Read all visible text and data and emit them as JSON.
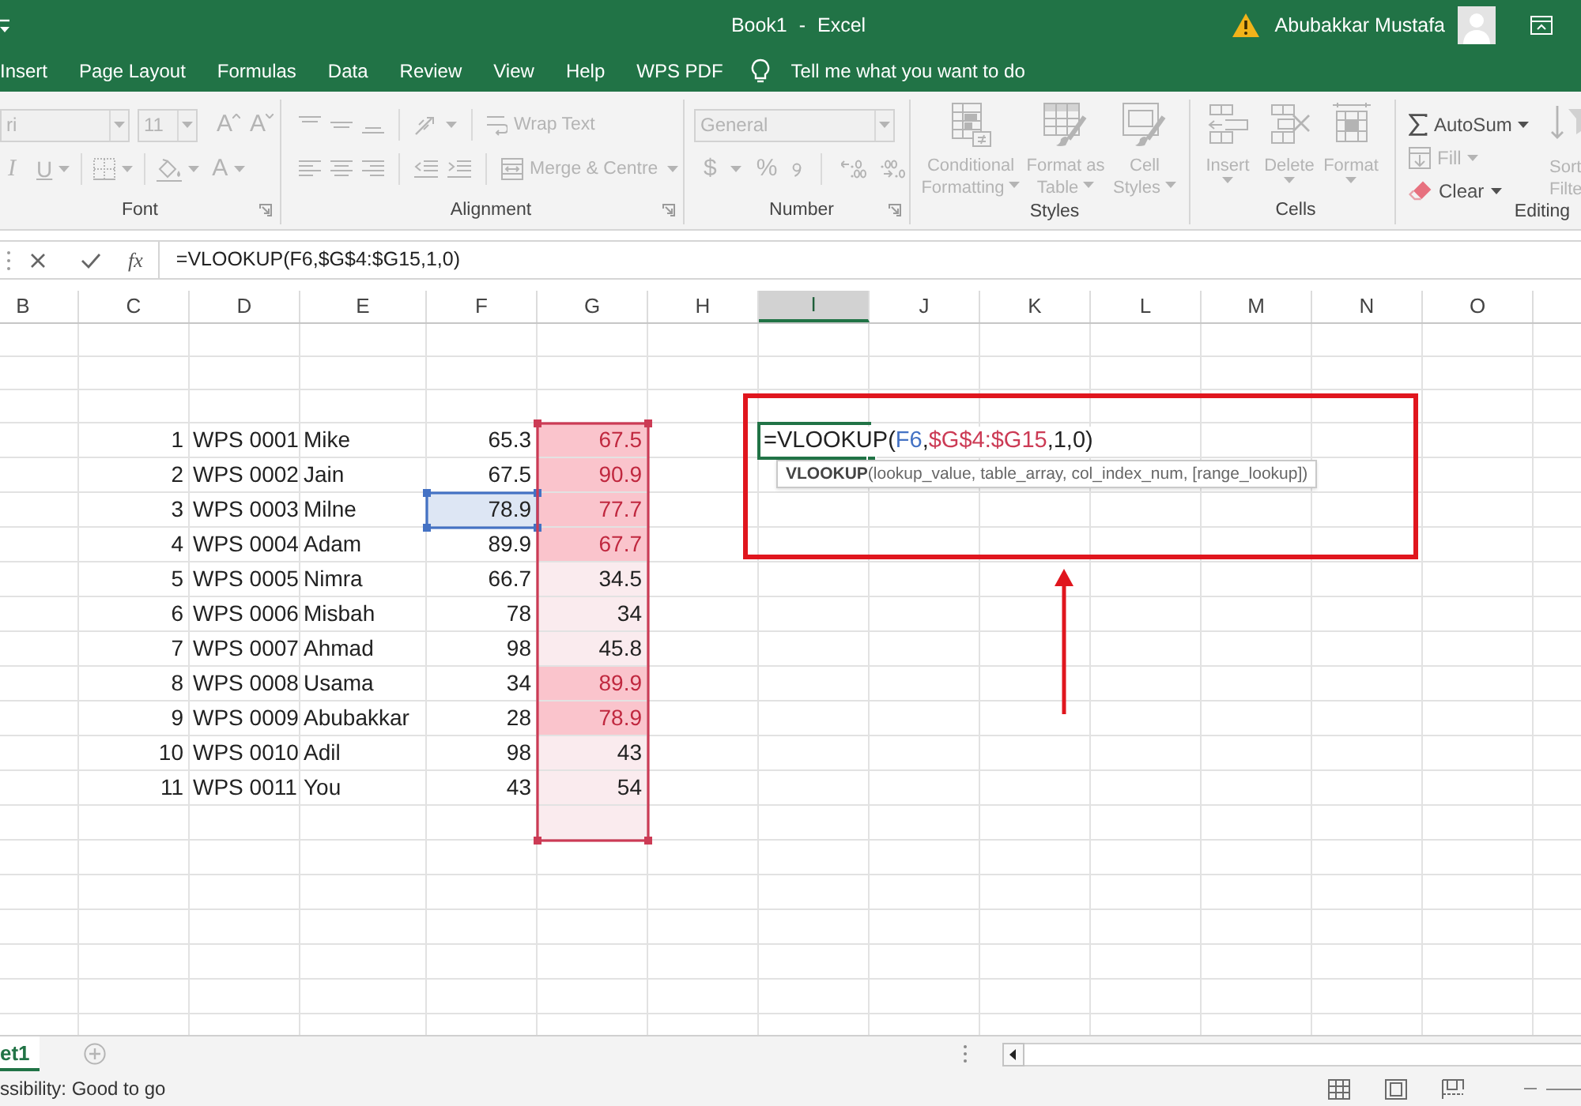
{
  "title_bar": {
    "title": "Book1 - Excel",
    "user": "Abubakkar Mustafa",
    "warning": true
  },
  "tabs": [
    {
      "label": "Insert",
      "selected": false
    },
    {
      "label": "Page Layout",
      "selected": false
    },
    {
      "label": "Formulas",
      "selected": false
    },
    {
      "label": "Data",
      "selected": false
    },
    {
      "label": "Review",
      "selected": false
    },
    {
      "label": "View",
      "selected": false
    },
    {
      "label": "Help",
      "selected": false
    },
    {
      "label": "WPS PDF",
      "selected": false
    }
  ],
  "tell_me": "Tell me what you want to do",
  "ribbon": {
    "groups": [
      {
        "kind": "font",
        "label": "Font",
        "disabled": true,
        "fields": [
          "ri",
          "11"
        ],
        "letters": [
          "A",
          "A",
          "I",
          "U",
          "A"
        ]
      },
      {
        "kind": "alignment",
        "label": "Alignment",
        "disabled": true,
        "buttons": [
          "Wrap Text",
          "Merge & Centre"
        ]
      },
      {
        "kind": "number",
        "label": "Number",
        "disabled": true,
        "format": "General",
        "symbols": [
          "$",
          "%"
        ]
      },
      {
        "kind": "styles",
        "label": "Styles",
        "disabled": true,
        "buttons": [
          [
            "Conditional",
            "Formatting"
          ],
          [
            "Format as",
            "Table"
          ],
          [
            "Cell",
            "Styles"
          ]
        ]
      },
      {
        "kind": "cells",
        "label": "Cells",
        "disabled": true,
        "buttons": [
          "Insert",
          "Delete",
          "Format"
        ]
      },
      {
        "kind": "editing",
        "label": "Editing",
        "disabled": false,
        "buttons": [
          {
            "label": "AutoSum",
            "disabled": false
          },
          {
            "label": "Fill",
            "disabled": true
          },
          {
            "label": "Clear",
            "disabled": false
          },
          {
            "lines": [
              "Sort",
              "Filte"
            ],
            "disabled": true
          }
        ]
      }
    ]
  },
  "formula_bar": {
    "function_button": "fx",
    "formula": "=VLOOKUP(F6,$G$4:$G15,1,0)"
  },
  "columns": [
    {
      "label": "B",
      "selected": false
    },
    {
      "label": "C",
      "selected": false
    },
    {
      "label": "D",
      "selected": false
    },
    {
      "label": "E",
      "selected": false
    },
    {
      "label": "F",
      "selected": false
    },
    {
      "label": "G",
      "selected": false
    },
    {
      "label": "H",
      "selected": false
    },
    {
      "label": "I",
      "selected": true
    },
    {
      "label": "J",
      "selected": false
    },
    {
      "label": "K",
      "selected": false
    },
    {
      "label": "L",
      "selected": false
    },
    {
      "label": "M",
      "selected": false
    },
    {
      "label": "N",
      "selected": false
    },
    {
      "label": "O",
      "selected": false
    }
  ],
  "rows": [
    {
      "C": "1",
      "D": "WPS 0001",
      "E": "Mike",
      "F": "65.3",
      "G": "67.5",
      "highlighted": true,
      "F_ref": false,
      "G_ref": true
    },
    {
      "C": "2",
      "D": "WPS 0002",
      "E": "Jain",
      "F": "67.5",
      "G": "90.9",
      "highlighted": true,
      "F_ref": false,
      "G_ref": true
    },
    {
      "C": "3",
      "D": "WPS 0003",
      "E": "Milne",
      "F": "78.9",
      "G": "77.7",
      "highlighted": true,
      "F_ref": true,
      "G_ref": true
    },
    {
      "C": "4",
      "D": "WPS 0004",
      "E": "Adam",
      "F": "89.9",
      "G": "67.7",
      "highlighted": true,
      "F_ref": false,
      "G_ref": true
    },
    {
      "C": "5",
      "D": "WPS 0005",
      "E": "Nimra",
      "F": "66.7",
      "G": "34.5",
      "highlighted": false,
      "F_ref": false,
      "G_ref": true
    },
    {
      "C": "6",
      "D": "WPS 0006",
      "E": "Misbah",
      "F": "78",
      "G": "34",
      "highlighted": false,
      "F_ref": false,
      "G_ref": true
    },
    {
      "C": "7",
      "D": "WPS 0007",
      "E": "Ahmad",
      "F": "98",
      "G": "45.8",
      "highlighted": false,
      "F_ref": false,
      "G_ref": true
    },
    {
      "C": "8",
      "D": "WPS 0008",
      "E": "Usama",
      "F": "34",
      "G": "89.9",
      "highlighted": true,
      "F_ref": false,
      "G_ref": true
    },
    {
      "C": "9",
      "D": "WPS 0009",
      "E": "Abubakkar",
      "F": "28",
      "G": "78.9",
      "highlighted": true,
      "F_ref": false,
      "G_ref": true
    },
    {
      "C": "10",
      "D": "WPS 0010",
      "E": "Adil",
      "F": "98",
      "G": "43",
      "highlighted": false,
      "F_ref": false,
      "G_ref": true
    },
    {
      "C": "11",
      "D": "WPS 0011",
      "E": "You",
      "F": "43",
      "G": "54",
      "highlighted": false,
      "F_ref": false,
      "G_ref": true
    },
    {
      "highlighted": false,
      "F_ref": false,
      "G_ref": true
    }
  ],
  "cell_editor": {
    "parts": [
      {
        "text": "=VLOOKUP(",
        "kind": "plain"
      },
      {
        "text": "F6",
        "kind": "reference",
        "color": "#4472c4",
        "separator": ","
      },
      {
        "text": "$G$4:$G15",
        "kind": "reference",
        "color": "#cc3b55"
      },
      {
        "text": ",1,0)",
        "kind": "plain"
      }
    ]
  },
  "tooltip": "**VLOOKUP**(lookup_value, table_array, col_index_num, [range_lookup])",
  "annotations": {
    "frame": true,
    "arrow": true
  },
  "sheet_tabs": [
    {
      "label": "et1",
      "selected": true
    }
  ],
  "status_bar": {
    "text": "ssibility: Good to go"
  }
}
